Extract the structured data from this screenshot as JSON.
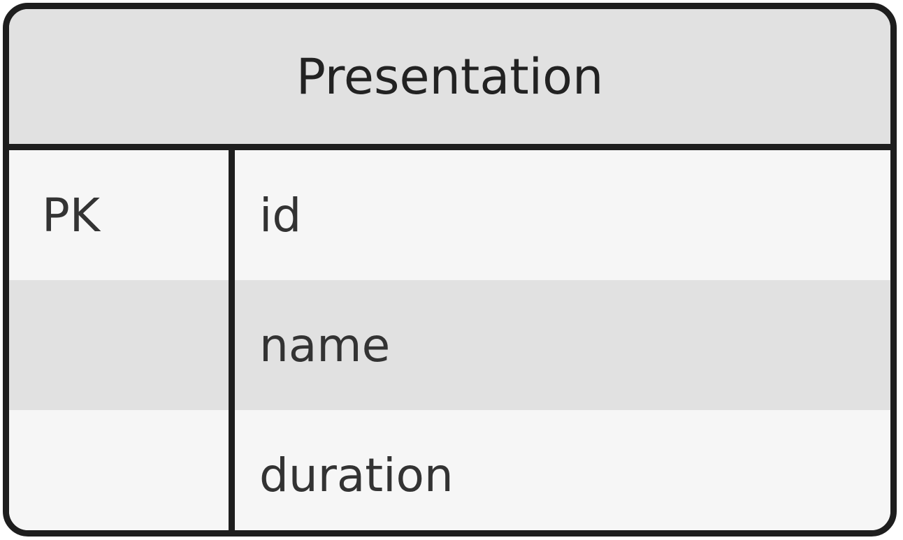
{
  "entity": {
    "title": "Presentation",
    "attributes": [
      {
        "key": "PK",
        "name": "id"
      },
      {
        "key": "",
        "name": "name"
      },
      {
        "key": "",
        "name": "duration"
      }
    ]
  },
  "colors": {
    "border": "#1e1e1e",
    "header_fill": "#e1e1e1",
    "row_fill_light": "#f6f6f6",
    "row_fill_dark": "#e1e1e1",
    "text": "#333333"
  }
}
